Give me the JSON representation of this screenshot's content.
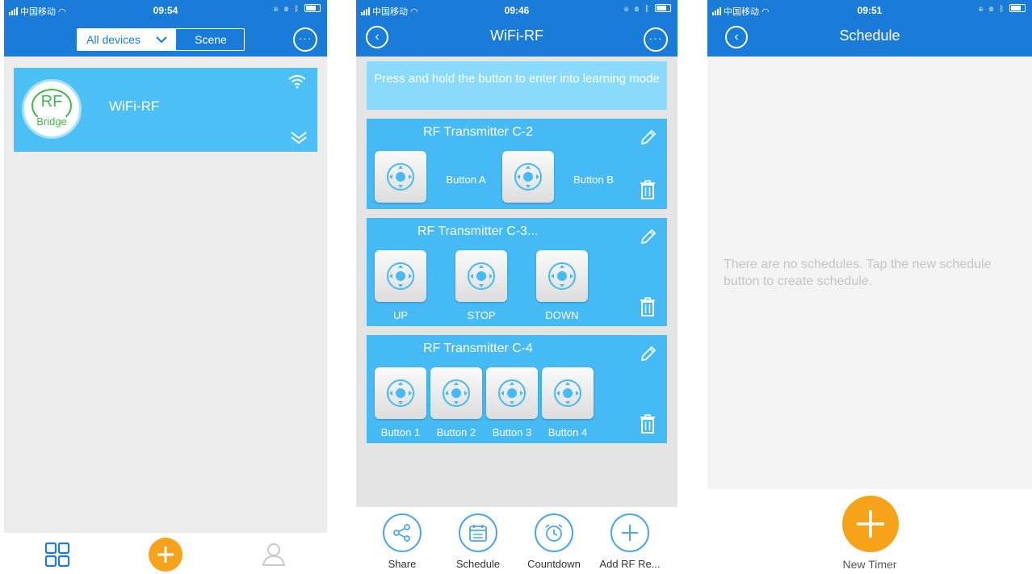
{
  "screen1": {
    "status": {
      "carrier": "中国移动",
      "time": "09:54"
    },
    "filter": {
      "all_devices": "All devices",
      "scene": "Scene"
    },
    "more_label": "···",
    "device": {
      "badge_top": "RF",
      "badge_bottom": "Bridge",
      "name": "WiFi-RF"
    },
    "tabbar": {
      "accent": "#f7a21b"
    }
  },
  "screen2": {
    "status": {
      "carrier": "中国移动",
      "time": "09:46"
    },
    "title": "WiFi-RF",
    "back_label": "‹",
    "more_label": "···",
    "hint": "Press and hold the button to enter into learning mode",
    "groups": [
      {
        "name": "RF Transmitter C-2",
        "buttons": [
          "Button A",
          "Button B"
        ]
      },
      {
        "name": "RF Transmitter C-3...",
        "buttons": [
          "UP",
          "STOP",
          "DOWN"
        ]
      },
      {
        "name": "RF Transmitter C-4",
        "buttons": [
          "Button 1",
          "Button 2",
          "Button 3",
          "Button 4"
        ]
      }
    ],
    "actions": [
      "Share",
      "Schedule",
      "Countdown",
      "Add RF Re..."
    ]
  },
  "screen3": {
    "status": {
      "carrier": "中国移动",
      "time": "09:51"
    },
    "title": "Schedule",
    "back_label": "‹",
    "empty": "There are no schedules. Tap the new schedule button to create schedule.",
    "new_timer": "New Timer"
  },
  "colors": {
    "header": "#1a7bd8",
    "card": "#45baf5",
    "accent": "#f7a21b"
  }
}
